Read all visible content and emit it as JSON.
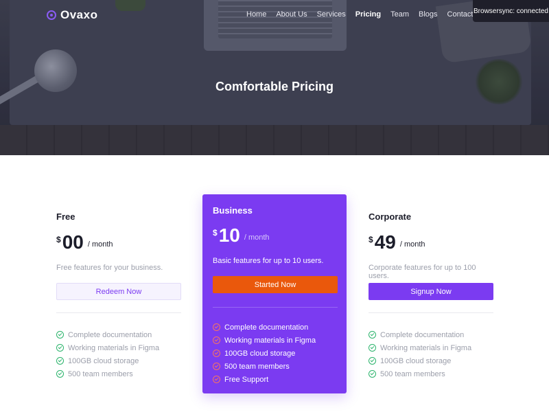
{
  "header": {
    "logo_text": "Ovaxo",
    "nav": [
      {
        "label": "Home",
        "active": false
      },
      {
        "label": "About Us",
        "active": false
      },
      {
        "label": "Services",
        "active": false
      },
      {
        "label": "Pricing",
        "active": true
      },
      {
        "label": "Team",
        "active": false
      },
      {
        "label": "Blogs",
        "active": false
      },
      {
        "label": "Contact us",
        "active": false
      }
    ],
    "browsersync": "Browsersync: connected"
  },
  "hero": {
    "title": "Comfortable Pricing"
  },
  "plans": {
    "free": {
      "name": "Free",
      "currency": "$",
      "amount": "00",
      "period": "/ month",
      "description": "Free features for your business.",
      "button": "Redeem Now",
      "features": [
        "Complete documentation",
        "Working materials in Figma",
        "100GB cloud storage",
        "500 team members"
      ]
    },
    "business": {
      "name": "Business",
      "currency": "$",
      "amount": "10",
      "period": "/ month",
      "description": "Basic features for up to 10 users.",
      "button": "Started Now",
      "features": [
        "Complete documentation",
        "Working materials in Figma",
        "100GB cloud storage",
        "500 team members",
        "Free Support"
      ]
    },
    "corporate": {
      "name": "Corporate",
      "currency": "$",
      "amount": "49",
      "period": "/ month",
      "description": "Corporate features for up to 100 users.",
      "button": "Signup Now",
      "features": [
        "Complete documentation",
        "Working materials in Figma",
        "100GB cloud storage",
        "500 team members"
      ]
    }
  },
  "colors": {
    "accent": "#7b3bf1",
    "cta_orange": "#ea580c",
    "check_green": "#29b36a",
    "check_coral": "#f97360"
  }
}
